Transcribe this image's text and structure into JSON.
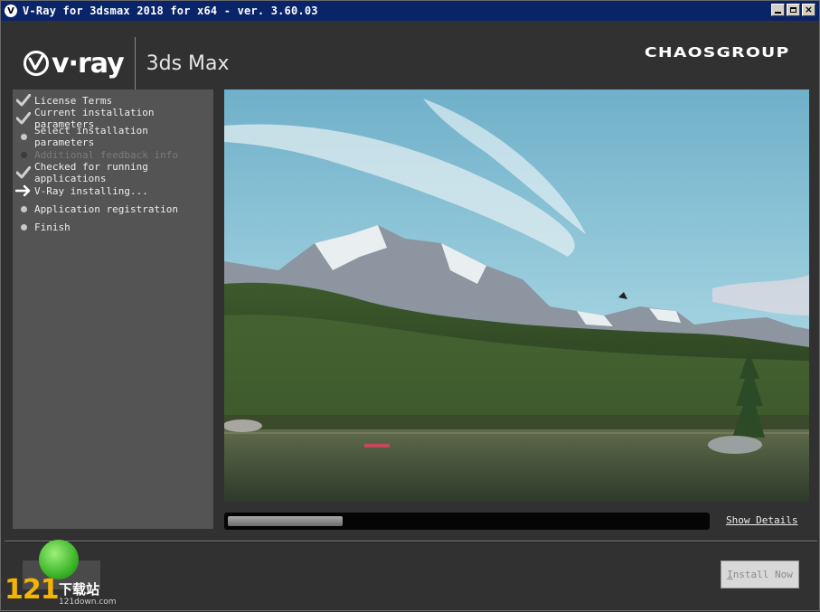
{
  "window": {
    "title": "V-Ray for 3dsmax 2018 for x64 - ver. 3.60.03",
    "icon": "vray-icon"
  },
  "header": {
    "vray_brand": "v·ray",
    "product": "3ds Max",
    "company": "CHAOSGROUP"
  },
  "steps": [
    {
      "label": "License Terms",
      "state": "done"
    },
    {
      "label": "Current installation parameters",
      "state": "done"
    },
    {
      "label": "Select installation parameters",
      "state": "pending"
    },
    {
      "label": "Additional feedback info",
      "state": "disabled"
    },
    {
      "label": "Checked for running applications",
      "state": "done"
    },
    {
      "label": "V-Ray installing...",
      "state": "current"
    },
    {
      "label": "Application registration",
      "state": "pending"
    },
    {
      "label": "Finish",
      "state": "pending"
    }
  ],
  "progress": {
    "fraction": 0.24
  },
  "show_details_label": "Show Details",
  "install_button": {
    "accel": "I",
    "rest": "nstall Now"
  },
  "watermark": {
    "number": "121",
    "cn": "下载站",
    "url": "121down.com"
  },
  "colors": {
    "titlebar": "#0a246a",
    "background": "#313131",
    "panel": "#545454"
  }
}
